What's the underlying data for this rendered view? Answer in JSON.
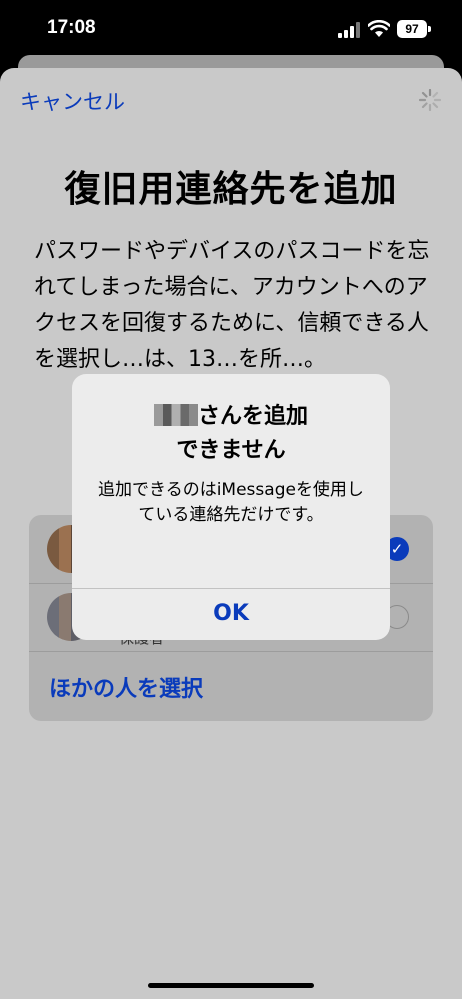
{
  "status_bar": {
    "time": "17:08",
    "battery": "97"
  },
  "nav": {
    "cancel_label": "キャンセル"
  },
  "page": {
    "title": "復旧用連絡先を追加",
    "description": "パスワードやデバイスのパスコードを忘れてしまった場合に、アカウントへのアクセスを回復するために、信頼できる人を選択し…は、13…を所…。"
  },
  "contacts": [
    {
      "subtitle": "",
      "selected": true
    },
    {
      "subtitle": "保護者",
      "selected": false
    }
  ],
  "other_label": "ほかの人を選択",
  "alert": {
    "title_suffix": "さんを追加",
    "title_line2": "できません",
    "message": "追加できるのはiMessageを使用している連絡先だけです。",
    "ok_label": "OK"
  },
  "colors": {
    "accent": "#0a3bbb",
    "sheet": "#c9c9c9"
  }
}
